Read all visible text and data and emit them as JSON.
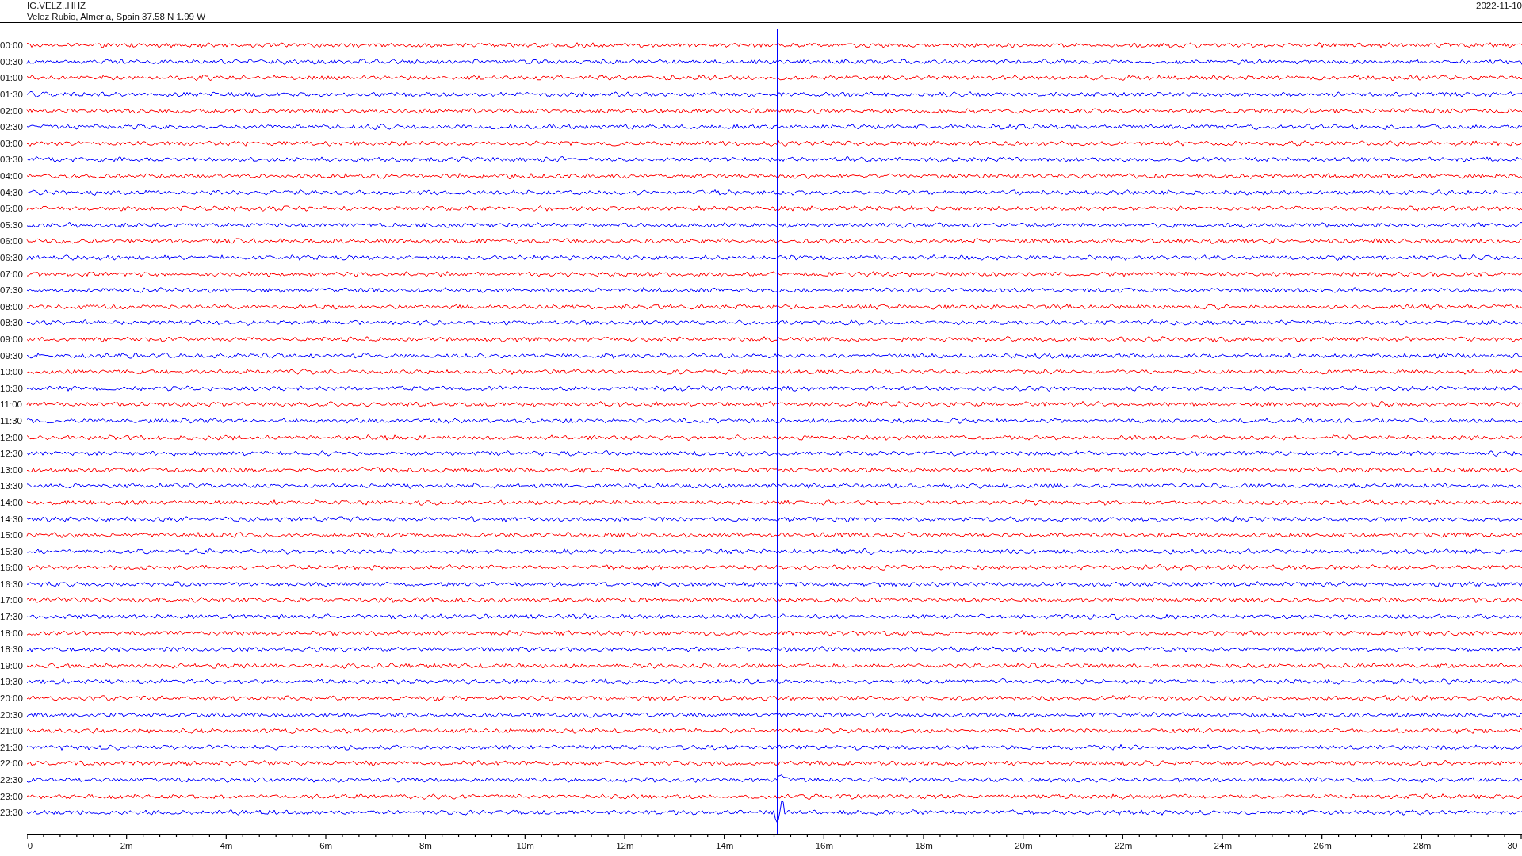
{
  "header": {
    "station": "IG.VELZ..HHZ",
    "location": "Velez Rubio, Almeria, Spain  37.58 N 1.99 W",
    "date": "2022-11-10"
  },
  "traces": [
    {
      "label": "00:00",
      "color": "#ff0000"
    },
    {
      "label": "00:30",
      "color": "#0000ff"
    },
    {
      "label": "01:00",
      "color": "#ff0000"
    },
    {
      "label": "01:30",
      "color": "#0000ff"
    },
    {
      "label": "02:00",
      "color": "#ff0000"
    },
    {
      "label": "02:30",
      "color": "#0000ff"
    },
    {
      "label": "03:00",
      "color": "#ff0000"
    },
    {
      "label": "03:30",
      "color": "#0000ff"
    },
    {
      "label": "04:00",
      "color": "#ff0000"
    },
    {
      "label": "04:30",
      "color": "#0000ff"
    },
    {
      "label": "05:00",
      "color": "#ff0000"
    },
    {
      "label": "05:30",
      "color": "#0000ff"
    },
    {
      "label": "06:00",
      "color": "#ff0000"
    },
    {
      "label": "06:30",
      "color": "#0000ff"
    },
    {
      "label": "07:00",
      "color": "#ff0000"
    },
    {
      "label": "07:30",
      "color": "#0000ff"
    },
    {
      "label": "08:00",
      "color": "#ff0000"
    },
    {
      "label": "08:30",
      "color": "#0000ff"
    },
    {
      "label": "09:00",
      "color": "#ff0000"
    },
    {
      "label": "09:30",
      "color": "#0000ff"
    },
    {
      "label": "10:00",
      "color": "#ff0000"
    },
    {
      "label": "10:30",
      "color": "#0000ff"
    },
    {
      "label": "11:00",
      "color": "#ff0000"
    },
    {
      "label": "11:30",
      "color": "#0000ff"
    },
    {
      "label": "12:00",
      "color": "#ff0000"
    },
    {
      "label": "12:30",
      "color": "#0000ff"
    },
    {
      "label": "13:00",
      "color": "#ff0000"
    },
    {
      "label": "13:30",
      "color": "#0000ff"
    },
    {
      "label": "14:00",
      "color": "#ff0000"
    },
    {
      "label": "14:30",
      "color": "#0000ff"
    },
    {
      "label": "15:00",
      "color": "#ff0000"
    },
    {
      "label": "15:30",
      "color": "#0000ff"
    },
    {
      "label": "16:00",
      "color": "#ff0000"
    },
    {
      "label": "16:30",
      "color": "#0000ff"
    },
    {
      "label": "17:00",
      "color": "#ff0000"
    },
    {
      "label": "17:30",
      "color": "#0000ff"
    },
    {
      "label": "18:00",
      "color": "#ff0000"
    },
    {
      "label": "18:30",
      "color": "#0000ff"
    },
    {
      "label": "19:00",
      "color": "#ff0000"
    },
    {
      "label": "19:30",
      "color": "#0000ff"
    },
    {
      "label": "20:00",
      "color": "#ff0000"
    },
    {
      "label": "20:30",
      "color": "#0000ff"
    },
    {
      "label": "21:00",
      "color": "#ff0000"
    },
    {
      "label": "21:30",
      "color": "#0000ff"
    },
    {
      "label": "22:00",
      "color": "#ff0000"
    },
    {
      "label": "22:30",
      "color": "#0000ff"
    },
    {
      "label": "23:00",
      "color": "#ff0000"
    },
    {
      "label": "23:30",
      "color": "#0000ff"
    }
  ],
  "x_axis": [
    "0",
    "2m",
    "4m",
    "6m",
    "8m",
    "10m",
    "12m",
    "14m",
    "16m",
    "18m",
    "20m",
    "22m",
    "24m",
    "26m",
    "28m",
    "30"
  ]
}
